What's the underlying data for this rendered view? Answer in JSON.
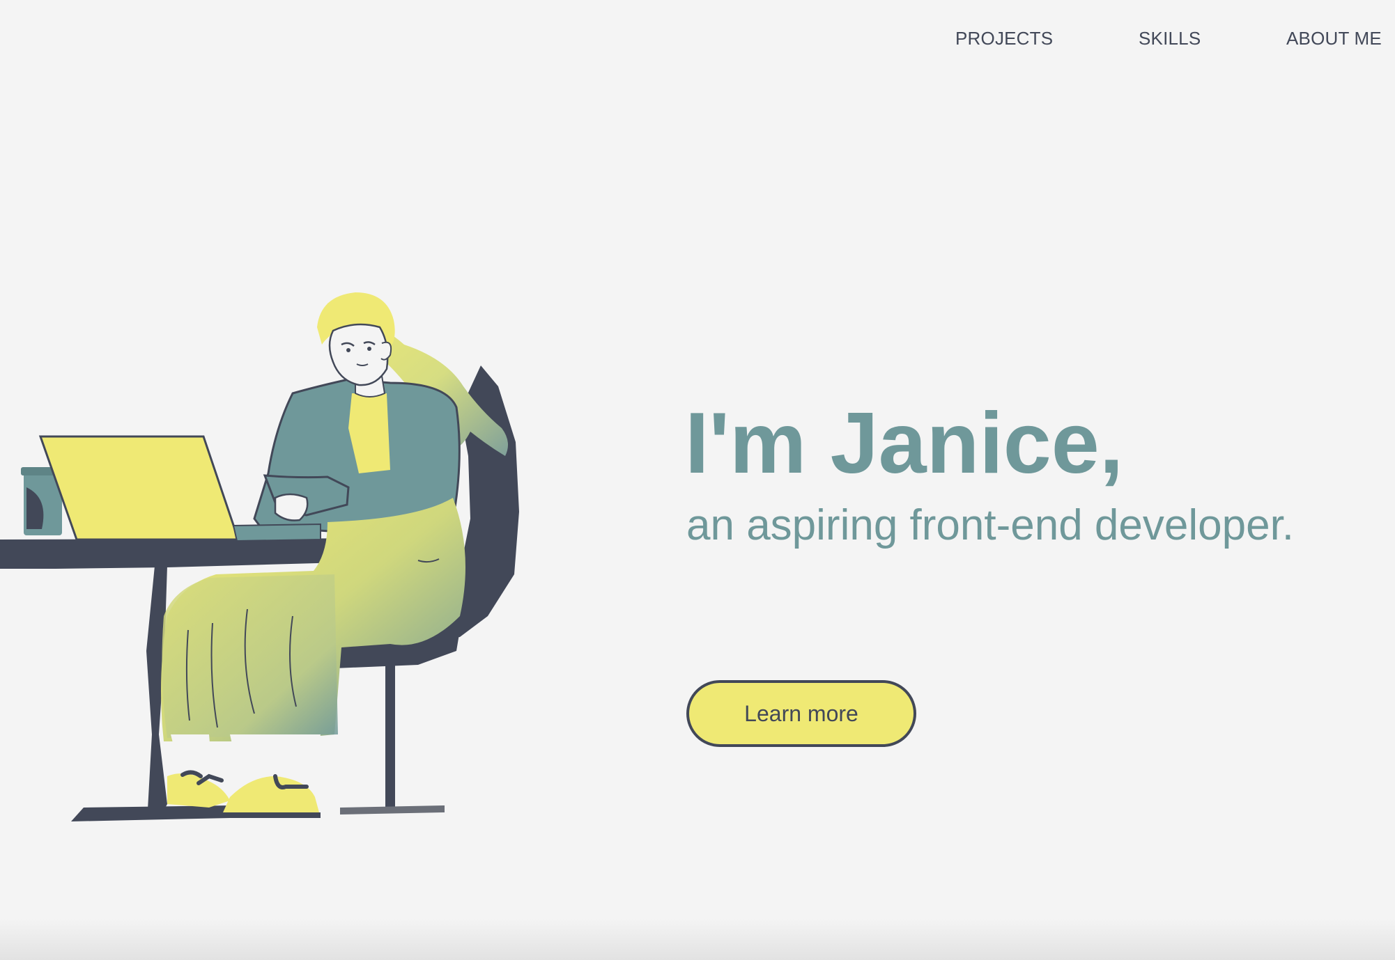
{
  "nav": {
    "items": [
      {
        "label": "PROJECTS"
      },
      {
        "label": "SKILLS"
      },
      {
        "label": "ABOUT ME"
      }
    ]
  },
  "hero": {
    "title": "I'm Janice,",
    "subtitle": "an aspiring front-end developer.",
    "cta_label": "Learn more"
  },
  "colors": {
    "background": "#f4f4f4",
    "accent_teal": "#6f989a",
    "accent_yellow": "#efe974",
    "dark_navy": "#424858"
  },
  "illustration": {
    "icon": "woman-at-laptop-illustration"
  }
}
